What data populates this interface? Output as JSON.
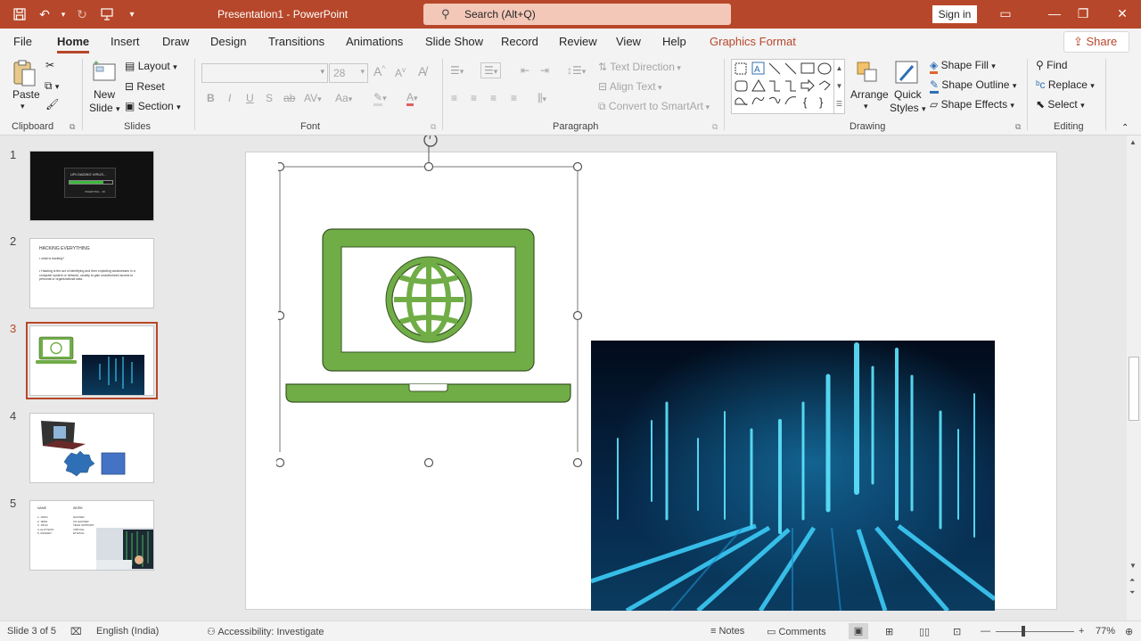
{
  "app": {
    "doc_title": "Presentation1 - PowerPoint",
    "search_text": "Search (Alt+Q)",
    "signin": "Sign in",
    "accent": "#b7472a"
  },
  "tabs": [
    "File",
    "Home",
    "Insert",
    "Draw",
    "Design",
    "Transitions",
    "Animations",
    "Slide Show",
    "Record",
    "Review",
    "View",
    "Help",
    "Graphics Format"
  ],
  "share": "Share",
  "ribbon": {
    "clipboard": {
      "paste": "Paste",
      "label": "Clipboard"
    },
    "slides": {
      "new_slide": "New",
      "new_slide2": "Slide",
      "layout": "Layout",
      "reset": "Reset",
      "section": "Section",
      "label": "Slides"
    },
    "font": {
      "size": "28",
      "bold": "B",
      "italic": "I",
      "underline": "U",
      "shadow": "S",
      "strike": "ab",
      "spacing": "AV",
      "case": "Aa",
      "label": "Font"
    },
    "paragraph": {
      "text_direction": "Text Direction",
      "align_text": "Align Text",
      "smartart": "Convert to SmartArt",
      "label": "Paragraph"
    },
    "drawing": {
      "arrange": "Arrange",
      "quick_styles": "Quick",
      "quick_styles2": "Styles",
      "shape_fill": "Shape Fill",
      "shape_outline": "Shape Outline",
      "shape_effects": "Shape Effects",
      "label": "Drawing"
    },
    "editing": {
      "find": "Find",
      "replace": "Replace",
      "select": "Select",
      "label": "Editing"
    }
  },
  "slides": [
    {
      "num": "1",
      "t1": "UPLOADING VIRUS...",
      "t2": "INSERTING... 99"
    },
    {
      "num": "2",
      "t1": "HACKING EVERYTHING",
      "t2": "• what is hacking?",
      "t3": "• Hacking is the act of identifying and then exploiting weaknesses in a computer system or network, usually to gain unauthorized access to personal or organizational data."
    },
    {
      "num": "3"
    },
    {
      "num": "4"
    },
    {
      "num": "5",
      "col1": "NAME",
      "col2": "WORK",
      "rows": [
        [
          "1. JOHN",
          "HACKER"
        ],
        [
          "2. JENG",
          "CS HACKER"
        ],
        [
          "3. JITHU",
          "TECH SUPPORT"
        ],
        [
          "4. ALOYSIUS",
          "VIRTUAL"
        ],
        [
          "5. ASAHEN",
          "ETHICAL"
        ]
      ]
    }
  ],
  "status": {
    "slide_info": "Slide 3 of 5",
    "language": "English (India)",
    "accessibility": "Accessibility: Investigate",
    "notes": "Notes",
    "comments": "Comments",
    "zoom": "77%"
  },
  "colors": {
    "laptop_green": "#70ad47",
    "laptop_stroke": "#375623"
  }
}
